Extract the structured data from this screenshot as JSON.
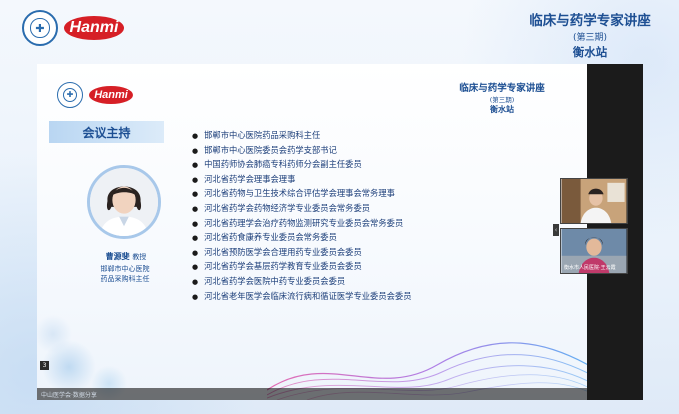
{
  "banner": {
    "hanmi_logo": "Hanmi",
    "title_main": "临床与药学专家讲座",
    "title_sub": "(第三期)",
    "title_city": "衡水站"
  },
  "slide": {
    "hanmi_logo": "Hanmi",
    "title_main": "临床与药学专家讲座",
    "title_sub": "(第三期)",
    "title_city": "衡水站",
    "section_label": "会议主持",
    "host": {
      "name": "曹源斐",
      "title": "教授",
      "org_line1": "邯郸市中心医院",
      "org_line2": "药品采购科主任"
    },
    "roles": [
      "邯郸市中心医院药品采购科主任",
      "邯郸市中心医院委员会药学支部书记",
      "中国药师协会肺癌专科药师分会副主任委员",
      "河北省药学会理事会理事",
      "河北省药物与卫生技术综合评估学会理事会常务理事",
      "河北省药学会药物经济学专业委员会常务委员",
      "河北省药理学会治疗药物监测研究专业委员会常务委员",
      "河北省药食康养专业委员会常务委员",
      "河北省预防医学会合理用药专业委员会委员",
      "河北省药学会基层药学教育专业委员会委员",
      "河北省药学会医院中药专业委员会委员",
      "河北省老年医学会临床流行病和循证医学专业委员会委员"
    ],
    "slide_number": "3",
    "caption": "中山医学会·数据分享"
  },
  "videos": [
    {
      "label": ""
    },
    {
      "label": "衡水市人民医院·王云霞"
    }
  ],
  "colors": {
    "brand_red": "#d61f26",
    "title_blue": "#1d4f93",
    "logo_blue": "#2a6cae",
    "frame_dark": "#1b1b1b"
  }
}
